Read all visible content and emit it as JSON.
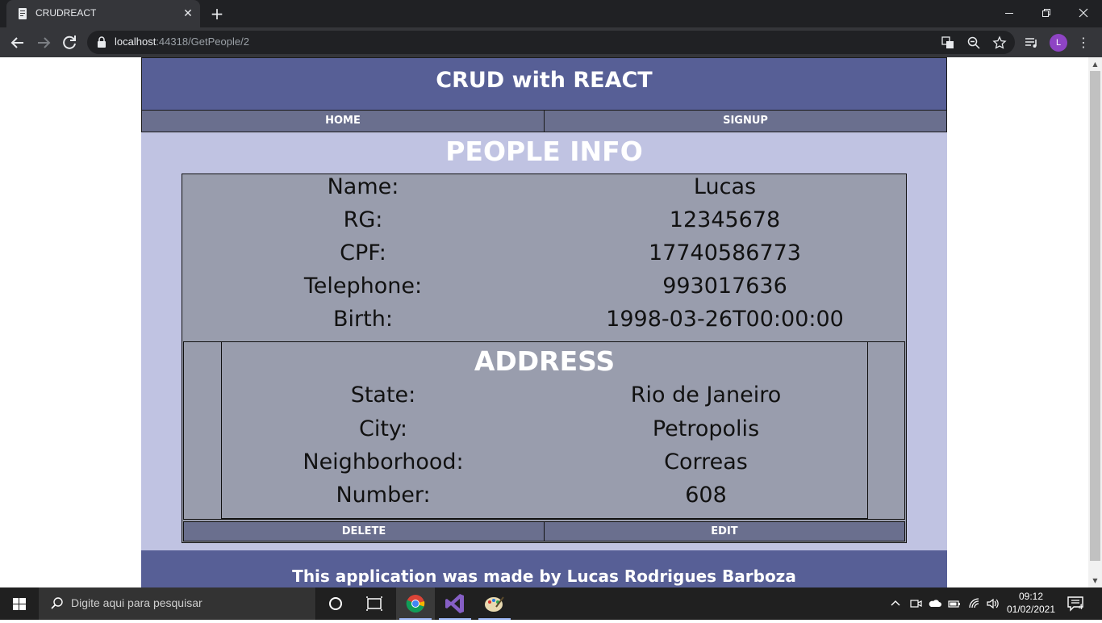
{
  "browser": {
    "tab_title": "CRUDREACT",
    "url_host": "localhost",
    "url_rest": ":44318/GetPeople/2",
    "profile_initial": "L",
    "accent_colors": {
      "titlebar": "#202124",
      "toolbar": "#35363a",
      "avatar": "#8e44c4"
    }
  },
  "app": {
    "title": "CRUD with REACT",
    "nav": {
      "home": "HOME",
      "signup": "SIGNUP"
    },
    "page_title": "PEOPLE INFO",
    "person": [
      {
        "label": "Name:",
        "value": "Lucas"
      },
      {
        "label": "RG:",
        "value": "12345678"
      },
      {
        "label": "CPF:",
        "value": "17740586773"
      },
      {
        "label": "Telephone:",
        "value": "993017636"
      },
      {
        "label": "Birth:",
        "value": "1998-03-26T00:00:00"
      }
    ],
    "address": {
      "title": "ADDRESS",
      "rows": [
        {
          "label": "State:",
          "value": "Rio de Janeiro"
        },
        {
          "label": "City:",
          "value": "Petropolis"
        },
        {
          "label": "Neighborhood:",
          "value": "Correas"
        },
        {
          "label": "Number:",
          "value": "608"
        }
      ]
    },
    "actions": {
      "delete": "DELETE",
      "edit": "EDIT"
    },
    "footer": "This application was made by Lucas Rodrigues Barboza",
    "colors": {
      "header": "#575f96",
      "nav": "#6a6f8e",
      "page_bg": "#c0c3e2",
      "card": "#999dad"
    }
  },
  "taskbar": {
    "search_placeholder": "Digite aqui para pesquisar",
    "time": "09:12",
    "date": "01/02/2021",
    "notification_count": "4"
  }
}
